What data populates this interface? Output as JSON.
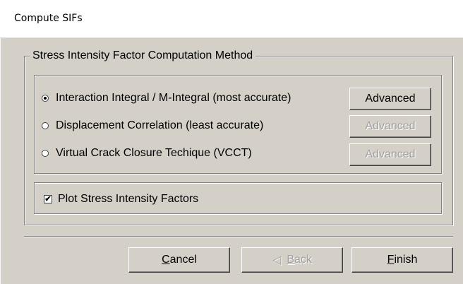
{
  "window": {
    "title": "Compute SIFs"
  },
  "method_group": {
    "legend": "Stress Intensity Factor Computation Method",
    "options": [
      {
        "label": "Interaction Integral / M-Integral (most accurate)",
        "selected": true,
        "advanced_label": "Advanced",
        "advanced_enabled": true
      },
      {
        "label": "Displacement Correlation (least accurate)",
        "selected": false,
        "advanced_label": "Advanced",
        "advanced_enabled": false
      },
      {
        "label": "Virtual Crack Closure Techique (VCCT)",
        "selected": false,
        "advanced_label": "Advanced",
        "advanced_enabled": false
      }
    ]
  },
  "plot_option": {
    "label": "Plot Stress Intensity Factors",
    "checked": true,
    "check_glyph": "✔"
  },
  "buttons": {
    "cancel": {
      "accel": "C",
      "rest": "ancel"
    },
    "back": {
      "arrow": "◁",
      "accel": "B",
      "rest": "ack",
      "enabled": false
    },
    "finish": {
      "accel": "F",
      "rest": "inish"
    }
  },
  "colors": {
    "face": "#d4d0c8",
    "title_bg": "#ffffff",
    "disabled_text": "#a0a0a0"
  }
}
